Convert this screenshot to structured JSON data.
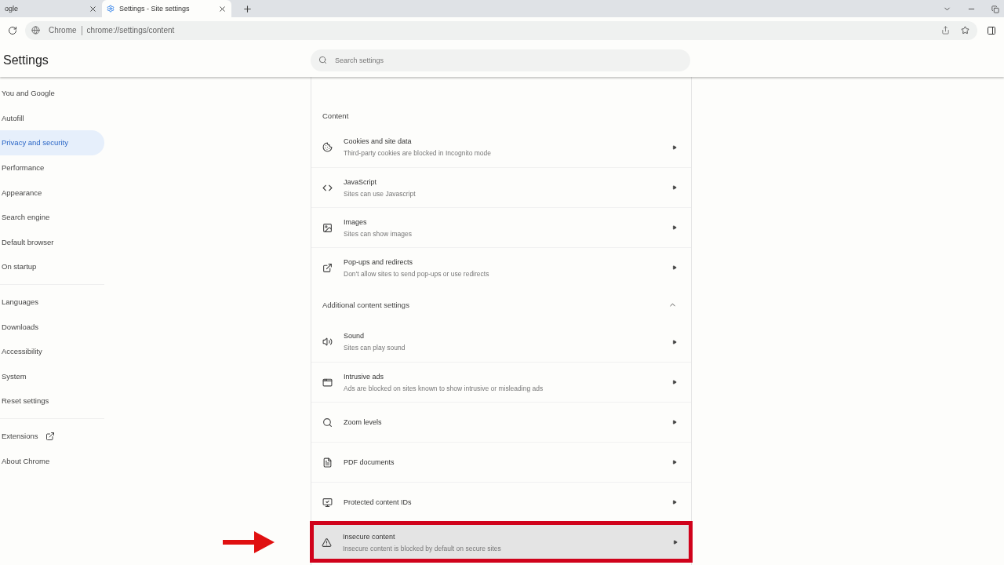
{
  "tabs": [
    {
      "title": "ogle",
      "selected": false
    },
    {
      "title": "Settings - Site settings",
      "selected": true
    }
  ],
  "address_bar": {
    "site_label": "Chrome",
    "url": "chrome://settings/content"
  },
  "header": {
    "title": "Settings",
    "search": {
      "placeholder": "Search settings"
    }
  },
  "sidebar": {
    "groups": [
      {
        "items": [
          {
            "label": "You and Google",
            "selected": false
          },
          {
            "label": "Autofill",
            "selected": false
          },
          {
            "label": "Privacy and security",
            "selected": true
          },
          {
            "label": "Performance",
            "selected": false
          },
          {
            "label": "Appearance",
            "selected": false
          },
          {
            "label": "Search engine",
            "selected": false
          },
          {
            "label": "Default browser",
            "selected": false
          },
          {
            "label": "On startup",
            "selected": false
          }
        ]
      },
      {
        "items": [
          {
            "label": "Languages",
            "selected": false
          },
          {
            "label": "Downloads",
            "selected": false
          },
          {
            "label": "Accessibility",
            "selected": false
          },
          {
            "label": "System",
            "selected": false
          },
          {
            "label": "Reset settings",
            "selected": false
          }
        ]
      },
      {
        "items": [
          {
            "label": "Extensions",
            "selected": false,
            "external": true
          },
          {
            "label": "About Chrome",
            "selected": false
          }
        ]
      }
    ]
  },
  "sections": [
    {
      "title": "Content",
      "kind": "label",
      "rows": [
        {
          "title": "Cookies and site data",
          "subtitle": "Third-party cookies are blocked in Incognito mode",
          "highlighted": false
        },
        {
          "title": "JavaScript",
          "subtitle": "Sites can use Javascript",
          "highlighted": false
        },
        {
          "title": "Images",
          "subtitle": "Sites can show images",
          "highlighted": false
        },
        {
          "title": "Pop-ups and redirects",
          "subtitle": "Don't allow sites to send pop-ups or use redirects",
          "highlighted": false
        }
      ]
    },
    {
      "title": "Additional content settings",
      "kind": "expander",
      "expanded": true,
      "rows": [
        {
          "title": "Sound",
          "subtitle": "Sites can play sound",
          "highlighted": false
        },
        {
          "title": "Intrusive ads",
          "subtitle": "Ads are blocked on sites known to show intrusive or misleading ads",
          "highlighted": false
        },
        {
          "title": "Zoom levels",
          "highlighted": false
        },
        {
          "title": "PDF documents",
          "highlighted": false
        },
        {
          "title": "Protected content IDs",
          "highlighted": false
        },
        {
          "title": "Insecure content",
          "subtitle": "Insecure content is blocked by default on secure sites",
          "highlighted": true
        }
      ]
    }
  ]
}
